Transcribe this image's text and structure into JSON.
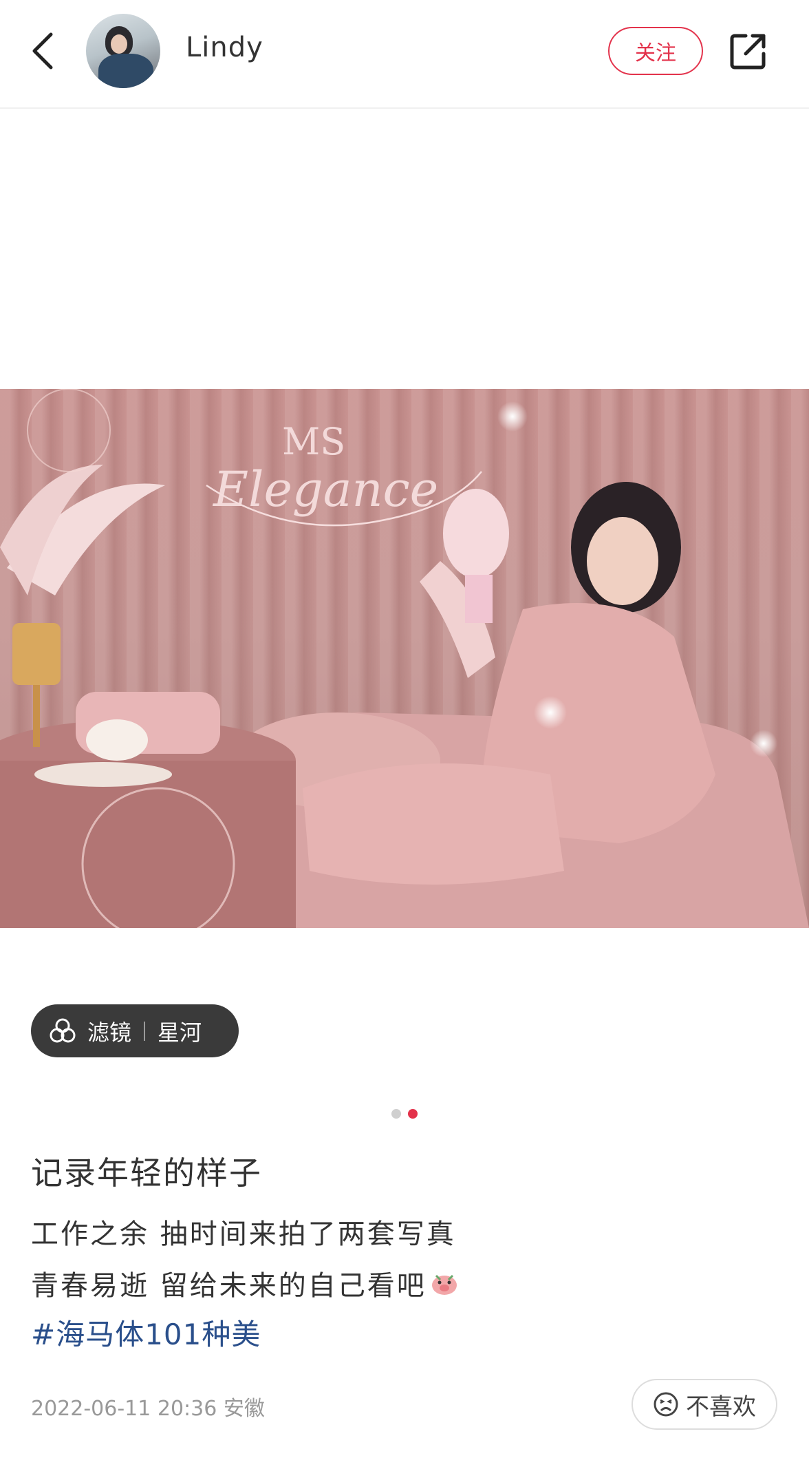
{
  "header": {
    "username": "Lindy",
    "follow_label": "关注"
  },
  "gallery": {
    "photo_logo_text": "MS Elegance",
    "filter_label": "滤镜",
    "filter_name": "星河",
    "page_count": 2,
    "active_page": 2
  },
  "post": {
    "title": "记录年轻的样子",
    "line1": "工作之余 抽时间来拍了两套写真",
    "line2": "青春易逝 留给未来的自己看吧",
    "hashtag": "#海马体101种美",
    "meta": "2022-06-11 20:36 安徽",
    "dislike_label": "不喜欢"
  },
  "colors": {
    "accent": "#e3324b",
    "hashtag": "#2a4f8b",
    "filter_bg": "#3a3a3a"
  },
  "icons": [
    "back-arrow-icon",
    "share-icon",
    "filter-icon",
    "sad-face-icon",
    "pig-emoji-icon"
  ]
}
